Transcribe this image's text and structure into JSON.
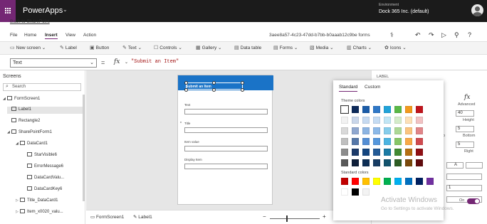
{
  "titlebar": {
    "app_name": "PowerApps",
    "chevron": "⌄",
    "env_label": "Environment",
    "env_name": "Dock 365 Inc. (default)"
  },
  "back_link": "Back to SharePoint",
  "menu": {
    "items": [
      "File",
      "Home",
      "Insert",
      "View",
      "Action"
    ],
    "active": "Insert",
    "app_id": "3aee8a57-4c23-47dd-b7bb-b0aaab12c9be forms",
    "icons": [
      "stethoscope-icon",
      "undo-icon",
      "redo-icon",
      "play-icon",
      "person-icon",
      "help-icon"
    ]
  },
  "ribbon": {
    "new_screen": "New screen",
    "label": "Label",
    "button": "Button",
    "text": "Text",
    "controls": "Controls",
    "gallery": "Gallery",
    "data_table": "Data table",
    "forms": "Forms",
    "media": "Media",
    "charts": "Charts",
    "icons": "Icons",
    "dropdown": "⌄"
  },
  "formula": {
    "property": "Text",
    "equals": "=",
    "fx": "fx",
    "expression": "\"Submit an Item\""
  },
  "tree": {
    "title": "Screens",
    "search_placeholder": "Search",
    "nodes": [
      {
        "label": "FormScreen1"
      },
      {
        "label": "Label1"
      },
      {
        "label": "Rectangle2"
      },
      {
        "label": "SharePointForm1"
      },
      {
        "label": "DataCard1"
      },
      {
        "label": "StarVisible6"
      },
      {
        "label": "ErrorMessage6"
      },
      {
        "label": "DataCardValu..."
      },
      {
        "label": "DataCardKey6"
      },
      {
        "label": "Title_DataCard1"
      },
      {
        "label": "Item_x0020_valu..."
      }
    ]
  },
  "form": {
    "header_text": "Submit an Item",
    "fields": [
      {
        "label": "Text",
        "required": false
      },
      {
        "label": "Title",
        "required": true
      },
      {
        "label": "Item value",
        "required": false
      },
      {
        "label": "Display Item",
        "required": false
      }
    ],
    "required_marker": "*"
  },
  "statusbar": {
    "screen_tab": "FormScreen1",
    "control_tab": "Label1",
    "zoom_minus": "−",
    "zoom_plus": "+"
  },
  "right_panel": {
    "section": "LABEL",
    "advanced": "Advanced",
    "fx": "fx",
    "height_value": "40",
    "height_label": "Height",
    "padding_value": "5",
    "bottom_label": "Bottom",
    "p_label": "p",
    "right_label": "Right",
    "font_a": "A",
    "spin_value": "1",
    "toggle_label": "On"
  },
  "color_picker": {
    "tabs": [
      "Standard",
      "Custom"
    ],
    "active_tab": "Standard",
    "theme_title": "Theme colors",
    "standard_title": "Standard colors",
    "theme_colors": [
      [
        "#ffffff",
        "#0d2a5a",
        "#1b5ca8",
        "#2f78c7",
        "#21a3d9",
        "#5ab947",
        "#f29a1d",
        "#c0141c"
      ],
      [
        "#f2f2f2",
        "#c9d6ea",
        "#c6daf1",
        "#c5dcf3",
        "#c1e6f5",
        "#d4ecca",
        "#fde0b7",
        "#f2c2c3"
      ],
      [
        "#d9d9d9",
        "#8fa7cf",
        "#8cb4e2",
        "#8cb9e8",
        "#86cdeb",
        "#acd896",
        "#fbc47e",
        "#e18588"
      ],
      [
        "#bfbfbf",
        "#5577a8",
        "#548ed4",
        "#5597dc",
        "#4cb4e1",
        "#87c668",
        "#f8a947",
        "#d04a4f"
      ],
      [
        "#8c8c8c",
        "#1c3a6a",
        "#14457f",
        "#235a96",
        "#1a7aa4",
        "#428a33",
        "#b56f12",
        "#8f0f14"
      ],
      [
        "#595959",
        "#0f1f3a",
        "#0d2e55",
        "#173c63",
        "#11526d",
        "#2c5c22",
        "#79490b",
        "#600a0d"
      ]
    ],
    "standard_colors": [
      [
        "#c00000",
        "#ff0000",
        "#ffc000",
        "#ffff00",
        "#00b050",
        "#00b0f0",
        "#0070c0",
        "#002060",
        "#7030a0"
      ],
      [
        "#ffffff",
        "#000000",
        "#f3f3f3"
      ]
    ]
  },
  "watermark": {
    "title": "Activate Windows",
    "subtitle": "Go to Settings to activate Windows."
  },
  "icons": {
    "waffle": "waffle-icon",
    "search": "search-icon",
    "avatar": "avatar-icon"
  }
}
